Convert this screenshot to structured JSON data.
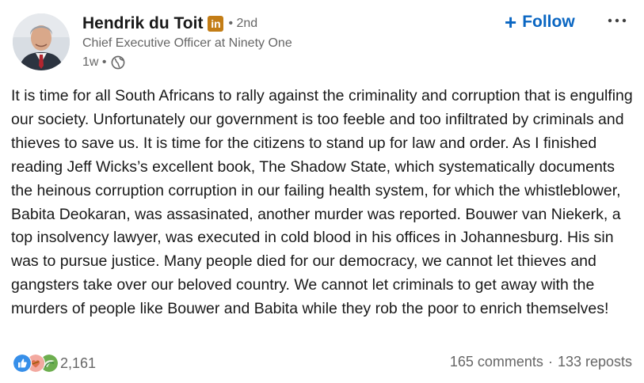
{
  "author": {
    "name": "Hendrik du Toit",
    "badge_text": "in",
    "degree": "• 2nd",
    "headline": "Chief Executive Officer at Ninety One",
    "time": "1w •",
    "visibility_icon": "globe-icon"
  },
  "actions": {
    "follow_icon": "+",
    "follow_label": "Follow",
    "more_icon": "ellipsis-icon"
  },
  "post": {
    "text": "It is time for all South Africans to rally against the criminality and corruption that is engulfing our society. Unfortunately our government is too feeble and too infiltrated by criminals and thieves to save us. It is time for the citizens to stand up for law and order. As I finished reading Jeff Wicks’s excellent book, The Shadow State, which systematically documents the heinous corruption corruption in our failing health system, for which the whistleblower, Babita Deokaran, was assasinated, another murder was reported. Bouwer van Niekerk, a top insolvency lawyer, was executed in cold blood in his offices in Johannesburg. His sin was to pursue justice. Many people died for our democracy, we cannot let thieves and gangsters take over our beloved country. We cannot let criminals to get away with the murders of people like Bouwer and Babita while they rob the poor to enrich themselves!"
  },
  "social": {
    "reaction_icons": [
      "like-icon",
      "love-icon",
      "support-icon"
    ],
    "reaction_count": "2,161",
    "comments": "165 comments",
    "separator": "·",
    "reposts": "133 reposts"
  },
  "colors": {
    "accent": "#0a66c2",
    "premium_badge": "#c37d16",
    "text": "#191919",
    "muted": "#666666"
  }
}
